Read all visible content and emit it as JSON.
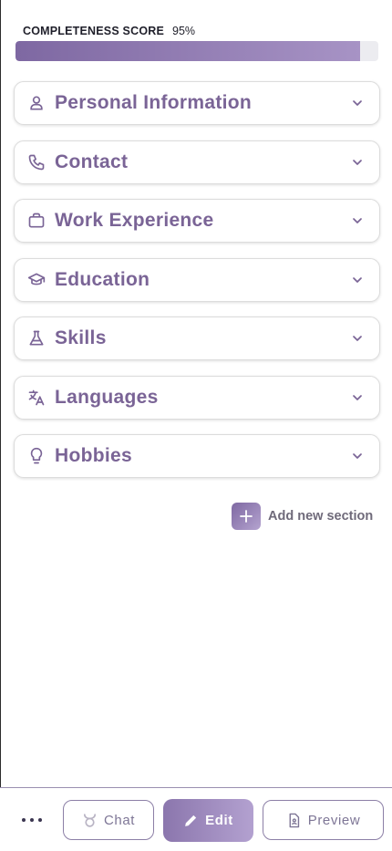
{
  "score": {
    "label": "COMPLETENESS SCORE",
    "value_text": "95%",
    "percent": 95
  },
  "sections": [
    {
      "label": "Personal Information",
      "icon": "person-icon"
    },
    {
      "label": "Contact",
      "icon": "phone-icon"
    },
    {
      "label": "Work Experience",
      "icon": "briefcase-icon"
    },
    {
      "label": "Education",
      "icon": "graduation-cap-icon"
    },
    {
      "label": "Skills",
      "icon": "flask-icon"
    },
    {
      "label": "Languages",
      "icon": "translate-icon"
    },
    {
      "label": "Hobbies",
      "icon": "lightbulb-icon"
    }
  ],
  "add_section": {
    "label": "Add new section"
  },
  "bottom_bar": {
    "chat_label": "Chat",
    "edit_label": "Edit",
    "preview_label": "Preview",
    "active_tab": "Edit"
  },
  "colors": {
    "accent": "#7a6496",
    "accent_light": "#b3a1d0",
    "text_dark": "#1f1f2a"
  }
}
